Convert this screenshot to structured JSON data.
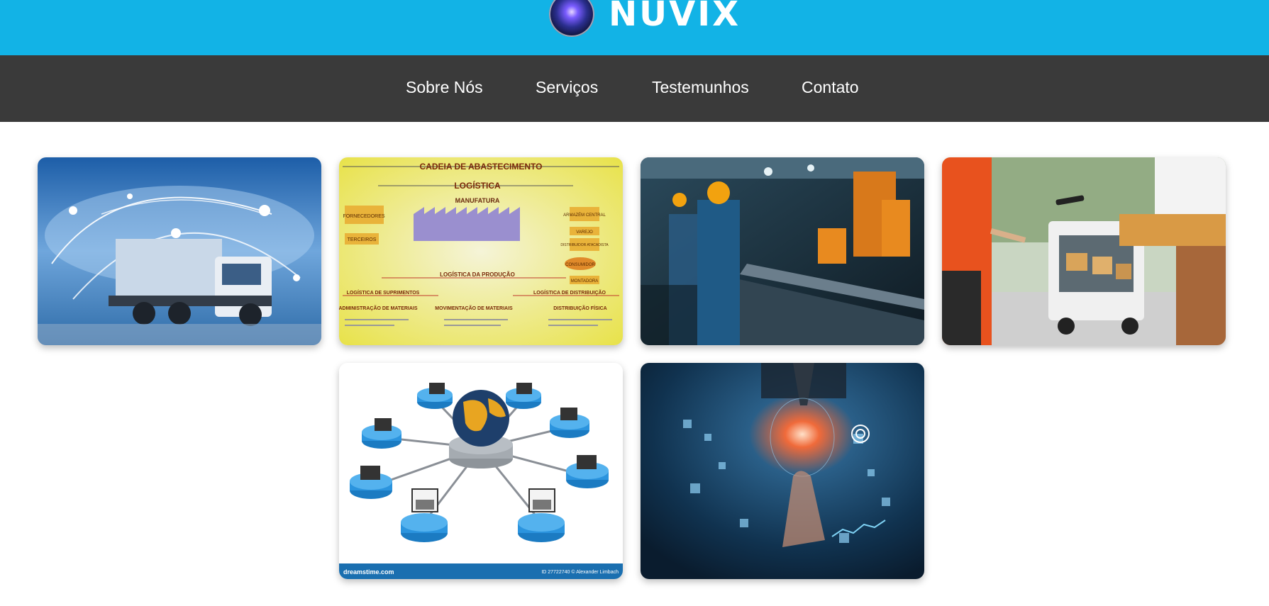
{
  "header": {
    "brand_name": "NUVIX",
    "logo_icon": "globe-orb-icon",
    "background": "#12b3e6"
  },
  "nav": {
    "background": "#3a3a3a",
    "items": [
      {
        "label": "Sobre Nós"
      },
      {
        "label": "Serviços"
      },
      {
        "label": "Testemunhos"
      },
      {
        "label": "Contato"
      }
    ]
  },
  "gallery": {
    "images": [
      {
        "subject": "truck-network-photo"
      },
      {
        "subject": "supply-chain-diagram",
        "texts": {
          "title": "CADEIA DE ABASTECIMENTO",
          "logistica": "LOGÍSTICA",
          "manufatura": "MANUFATURA",
          "fornecedores": "FORNECEDORES",
          "terceiros": "TERCEIROS",
          "armazem": "ARMAZÉM CENTRAL",
          "varejo": "VAREJO",
          "distribuidor": "DISTRIBUIDOR ATACADISTA",
          "consumidor": "CONSUMIDOR",
          "montadora": "MONTADORA",
          "producao": "LOGÍSTICA DA PRODUÇÃO",
          "suprimentos": "LOGÍSTICA DE SUPRIMENTOS",
          "distribuicao": "LOGÍSTICA DE DISTRIBUIÇÃO",
          "adm_materiais": "ADMINISTRAÇÃO DE MATERIAIS",
          "mov_materiais": "MOVIMENTAÇÃO DE MATERIAIS",
          "dist_fisica": "DISTRIBUIÇÃO FÍSICA"
        }
      },
      {
        "subject": "factory-workers-photo"
      },
      {
        "subject": "package-delivery-photo"
      },
      {
        "subject": "network-globe-laptops-illustration",
        "texts": {
          "watermark": "dreamstime.com",
          "credit": "ID 27722740 © Alexander Limbach"
        }
      },
      {
        "subject": "digital-technology-businessman-photo"
      }
    ]
  }
}
